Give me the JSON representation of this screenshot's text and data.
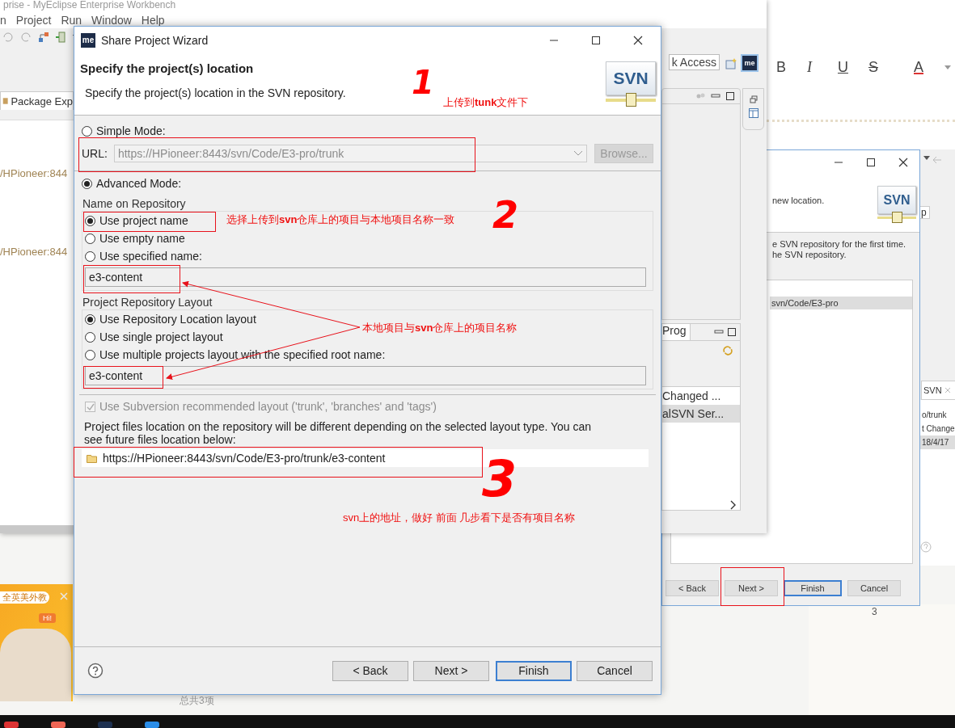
{
  "ide_window": {
    "title": "prise - MyEclipse Enterprise Workbench",
    "menu": [
      "n",
      "Project",
      "Run",
      "Window",
      "Help"
    ],
    "quick_access": "k Access",
    "app_logo": "me",
    "explorer_tab": "Package Exp",
    "tree_items": [
      "/HPioneer:844",
      "/HPioneer:844"
    ],
    "progress_tab": "Prog",
    "progress_rows": [
      {
        "text": "Changed ...",
        "selected": false
      },
      {
        "text": "alSVN Ser...",
        "selected": true
      }
    ]
  },
  "editor_toolbar": [
    "B",
    "I",
    "U",
    "S",
    "A"
  ],
  "back_dialog": {
    "banner_logo": "SVN",
    "description": "new location.",
    "message_lines": [
      "e SVN repository for the first time.",
      "he SVN repository."
    ],
    "list_rows": [
      {
        "text": "svn/Code/E3-pro",
        "selected": true
      }
    ],
    "buttons": [
      {
        "label": "< Back",
        "default": false
      },
      {
        "label": "Next >",
        "default": false
      },
      {
        "label": "Finish",
        "default": true
      },
      {
        "label": "Cancel",
        "default": false
      }
    ]
  },
  "svn_view": {
    "tab_fragment": "p",
    "tab": "SVN",
    "rows": [
      {
        "text": "o/trunk",
        "selected": false
      },
      {
        "text": "t Change",
        "selected": false
      },
      {
        "text": "18/4/17",
        "selected": true
      }
    ]
  },
  "page_number": "3",
  "ad": {
    "badge": "全英美外教",
    "bubble": "Hi!"
  },
  "list_footer": "总共3项",
  "wizard": {
    "title": "Share Project Wizard",
    "app_logo": "me",
    "banner_logo": "SVN",
    "heading": "Specify the project(s) location",
    "description": "Specify the project(s) location in the SVN repository.",
    "simple_mode": {
      "label": "Simple Mode:",
      "selected": false
    },
    "url": {
      "label": "URL:",
      "value": "https://HPioneer:8443/svn/Code/E3-pro/trunk",
      "disabled": true
    },
    "browse": {
      "label": "Browse...",
      "disabled": true
    },
    "advanced_mode": {
      "label": "Advanced Mode:",
      "selected": true
    },
    "name_group": {
      "title": "Name on Repository",
      "options": [
        {
          "label": "Use project name",
          "selected": true
        },
        {
          "label": "Use empty name",
          "selected": false
        },
        {
          "label": "Use specified name:",
          "selected": false
        }
      ],
      "value": "e3-content"
    },
    "layout_group": {
      "title": "Project Repository Layout",
      "options": [
        {
          "label": "Use Repository Location layout",
          "selected": true
        },
        {
          "label": "Use single project layout",
          "selected": false
        },
        {
          "label": "Use multiple projects layout with the specified root name:",
          "selected": false
        }
      ],
      "value": "e3-content"
    },
    "recommended_layout": {
      "label": "Use Subversion recommended layout ('trunk', 'branches' and 'tags')",
      "checked": true,
      "disabled": true
    },
    "info": "Project files location on the repository will be different depending on the selected layout type. You can see future files location below:",
    "location": "https://HPioneer:8443/svn/Code/E3-pro/trunk/e3-content",
    "buttons": [
      {
        "label": "< Back",
        "default": false
      },
      {
        "label": "Next >",
        "default": false
      },
      {
        "label": "Finish",
        "default": true
      },
      {
        "label": "Cancel",
        "default": false
      }
    ]
  },
  "annotations": {
    "notes": [
      "上传到**tunk**文件下",
      "选择上传到**svn**仓库上的项目与本地项目名称一致",
      "本地项目与**svn**仓库上的项目名称",
      "svn上的地址，做好 前面 几步看下是否有项目名称"
    ],
    "step_numbers": [
      "1",
      "2",
      "3"
    ]
  }
}
